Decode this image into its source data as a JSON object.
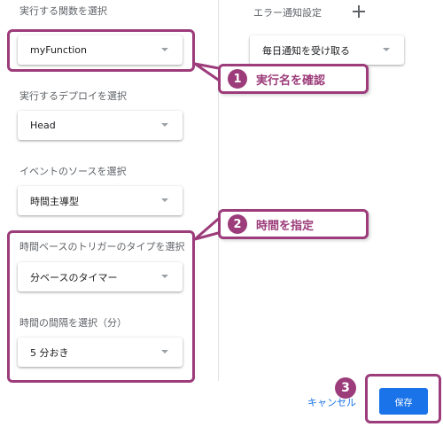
{
  "left_panel": {
    "function_label": "実行する関数を選択",
    "function_value": "myFunction",
    "deploy_label": "実行するデプロイを選択",
    "deploy_value": "Head",
    "event_source_label": "イベントのソースを選択",
    "event_source_value": "時間主導型",
    "trigger_type_label": "時間ベースのトリガーのタイプを選択",
    "trigger_type_value": "分ベースのタイマー",
    "interval_label": "時間の間隔を選択（分）",
    "interval_value": "5 分おき"
  },
  "right_panel": {
    "error_label": "エラー通知設定",
    "error_value": "毎日通知を受け取る"
  },
  "footer": {
    "cancel_label": "キャンセル",
    "save_label": "保存"
  },
  "annotations": {
    "callout1_number": "1",
    "callout1_text": "実行名を確認",
    "callout2_number": "2",
    "callout2_text": "時間を指定",
    "badge3_number": "3"
  },
  "icons": {
    "dropdown": "chevron-down-icon",
    "add": "plus-icon"
  },
  "colors": {
    "annotation": "#9c3c7a",
    "primary": "#1a73e8",
    "label": "#5f6368"
  }
}
